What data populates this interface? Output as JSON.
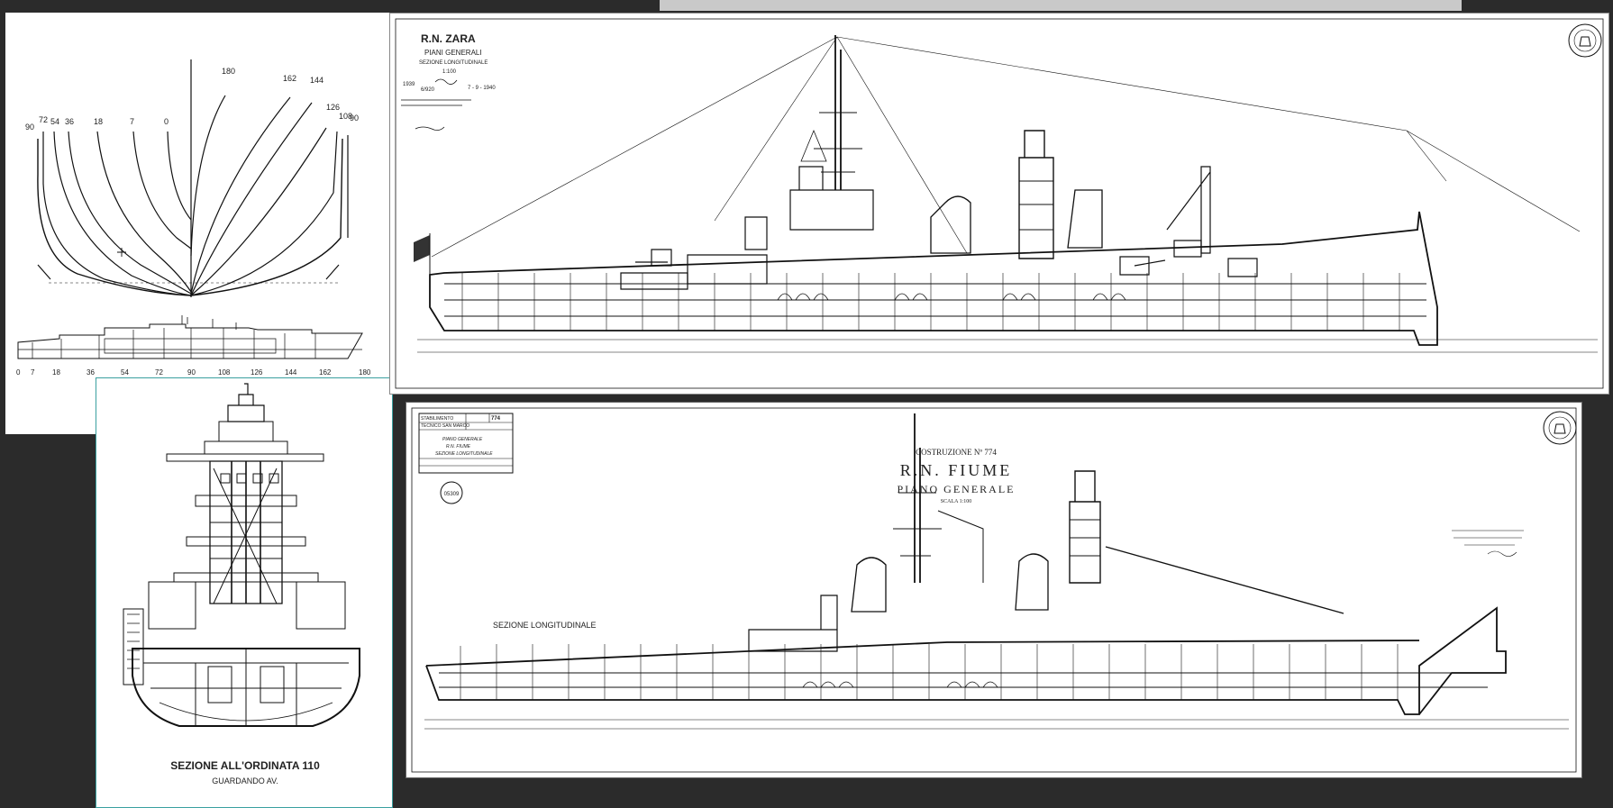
{
  "lines_plan": {
    "station_labels": [
      "90",
      "72",
      "54",
      "36",
      "18",
      "7",
      "0",
      "180",
      "162",
      "144",
      "126",
      "108",
      "90"
    ],
    "scale_labels": [
      "0",
      "7",
      "18",
      "36",
      "54",
      "72",
      "90",
      "108",
      "126",
      "144",
      "162",
      "180"
    ]
  },
  "zara": {
    "title": "R.N. ZARA",
    "subtitle_1": "PIANI GENERALI",
    "subtitle_2": "SEZIONE LONGITUDINALE",
    "scale": "1:100",
    "year": "1939",
    "number": "6/920",
    "date": "7 - 9 - 1940"
  },
  "fiume": {
    "construction": "COSTRUZIONE Nº 774",
    "title": "R.N. FIUME",
    "subtitle": "PIANO GENERALE",
    "scale": "SCALA 1:100",
    "section_label": "SEZIONE LONGITUDINALE",
    "box_line_1": "STABILIMENTO",
    "box_line_2": "TECNICO SAN MARCO",
    "box_line_3": "PIANO GENERALE",
    "box_line_4": "R.N. FIUME",
    "box_line_5": "SEZIONE LONGITUDINALE",
    "stamp": "05309",
    "box_number": "774"
  },
  "section": {
    "caption_1": "SEZIONE ALL'ORDINATA 110",
    "caption_2": "GUARDANDO AV."
  }
}
